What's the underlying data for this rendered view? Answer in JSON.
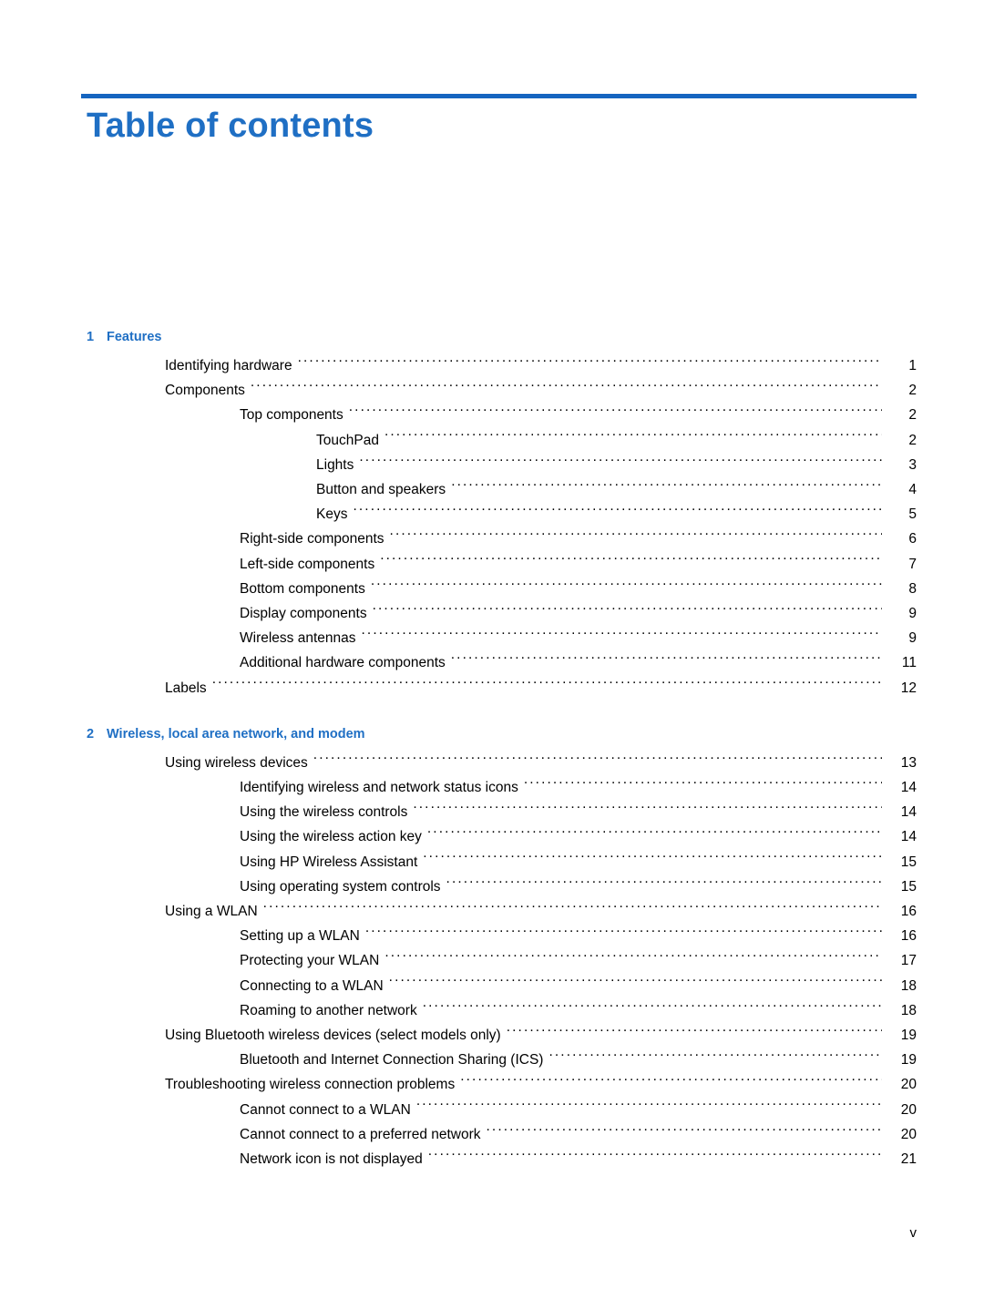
{
  "document": {
    "title": "Table of contents",
    "footer_page": "v"
  },
  "toc": {
    "chapters": [
      {
        "number": "1",
        "title": "Features",
        "entries": [
          {
            "label": "Identifying hardware",
            "page": "1",
            "level": 1
          },
          {
            "label": "Components",
            "page": "2",
            "level": 1
          },
          {
            "label": "Top components",
            "page": "2",
            "level": 2
          },
          {
            "label": "TouchPad",
            "page": "2",
            "level": 3
          },
          {
            "label": "Lights",
            "page": "3",
            "level": 3
          },
          {
            "label": "Button and speakers",
            "page": "4",
            "level": 3
          },
          {
            "label": "Keys",
            "page": "5",
            "level": 3
          },
          {
            "label": "Right-side components",
            "page": "6",
            "level": 2
          },
          {
            "label": "Left-side components",
            "page": "7",
            "level": 2
          },
          {
            "label": "Bottom components",
            "page": "8",
            "level": 2
          },
          {
            "label": "Display components",
            "page": "9",
            "level": 2
          },
          {
            "label": "Wireless antennas",
            "page": "9",
            "level": 2
          },
          {
            "label": "Additional hardware components",
            "page": "11",
            "level": 2
          },
          {
            "label": "Labels",
            "page": "12",
            "level": 1
          }
        ]
      },
      {
        "number": "2",
        "title": "Wireless, local area network, and modem",
        "entries": [
          {
            "label": "Using wireless devices",
            "page": "13",
            "level": 1
          },
          {
            "label": "Identifying wireless and network status icons",
            "page": "14",
            "level": 2
          },
          {
            "label": "Using the wireless controls",
            "page": "14",
            "level": 2
          },
          {
            "label": "Using the wireless action key",
            "page": "14",
            "level": 2
          },
          {
            "label": "Using HP Wireless Assistant",
            "page": "15",
            "level": 2
          },
          {
            "label": "Using operating system controls",
            "page": "15",
            "level": 2
          },
          {
            "label": "Using a WLAN",
            "page": "16",
            "level": 1
          },
          {
            "label": "Setting up a WLAN",
            "page": "16",
            "level": 2
          },
          {
            "label": "Protecting your WLAN",
            "page": "17",
            "level": 2
          },
          {
            "label": "Connecting to a WLAN",
            "page": "18",
            "level": 2
          },
          {
            "label": "Roaming to another network",
            "page": "18",
            "level": 2
          },
          {
            "label": "Using Bluetooth wireless devices (select models only)",
            "page": "19",
            "level": 1
          },
          {
            "label": "Bluetooth and Internet Connection Sharing (ICS)",
            "page": "19",
            "level": 2
          },
          {
            "label": "Troubleshooting wireless connection problems",
            "page": "20",
            "level": 1
          },
          {
            "label": "Cannot connect to a WLAN",
            "page": "20",
            "level": 2
          },
          {
            "label": "Cannot connect to a preferred network",
            "page": "20",
            "level": 2
          },
          {
            "label": "Network icon is not displayed",
            "page": "21",
            "level": 2
          }
        ]
      }
    ]
  }
}
